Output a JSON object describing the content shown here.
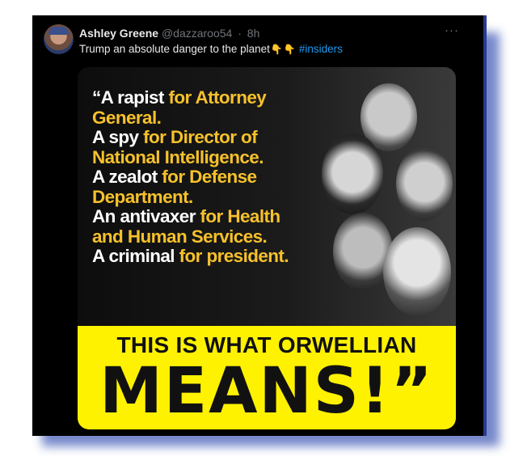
{
  "tweet": {
    "display_name": "Ashley Greene",
    "handle": "@dazzaroo54",
    "time": "8h",
    "more_label": "···",
    "text": "Trump an absolute danger to the planet",
    "emoji": [
      "👇",
      "👇"
    ],
    "hashtag": "#insiders"
  },
  "meme": {
    "lines": [
      {
        "white": "“A rapist",
        "yellow": " for Attorney"
      },
      {
        "white": "",
        "yellow": "General."
      },
      {
        "white": "A spy",
        "yellow": " for Director of"
      },
      {
        "white": "",
        "yellow": "National Intelligence."
      },
      {
        "white": "A zealot",
        "yellow": " for Defense"
      },
      {
        "white": "",
        "yellow": "Department."
      },
      {
        "white": "An antivaxer",
        "yellow": " for Health"
      },
      {
        "white": "",
        "yellow": "and Human Services."
      },
      {
        "white": "A criminal",
        "yellow": " for president."
      }
    ],
    "banner_line1": "THIS IS WHAT ORWELLIAN",
    "banner_line2": "MEANS!”"
  },
  "colors": {
    "card_bg": "#000000",
    "link_blue": "#1d9bf0",
    "meme_yellow_text": "#f6c12b",
    "banner_yellow": "#fff200"
  }
}
